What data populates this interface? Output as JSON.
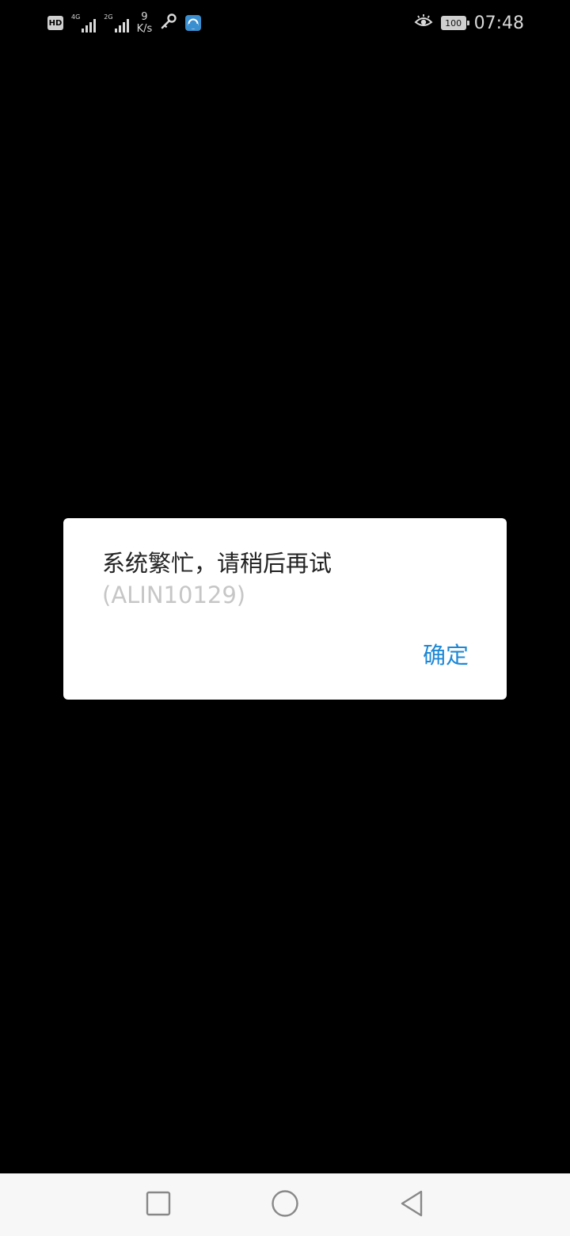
{
  "status_bar": {
    "hd_label": "HD",
    "network_1_label": "4G",
    "network_2_label": "2G",
    "speed_value": "9",
    "speed_unit": "K/s",
    "battery_level": "100",
    "time": "07:48",
    "icons": [
      "hd-icon",
      "signal-4g-icon",
      "signal-2g-icon",
      "key-icon",
      "app-notification-icon",
      "eye-comfort-icon",
      "battery-icon"
    ]
  },
  "dialog": {
    "message": "系统繁忙，请稍后再试",
    "error_code": "(ALIN10129)",
    "confirm_label": "确定"
  },
  "nav_bar": {
    "icons": [
      "recents-square-icon",
      "home-circle-icon",
      "back-triangle-icon"
    ]
  },
  "colors": {
    "background": "#000000",
    "dialog_bg": "#ffffff",
    "accent": "#1e88d6",
    "nav_bg": "#f7f7f7"
  }
}
